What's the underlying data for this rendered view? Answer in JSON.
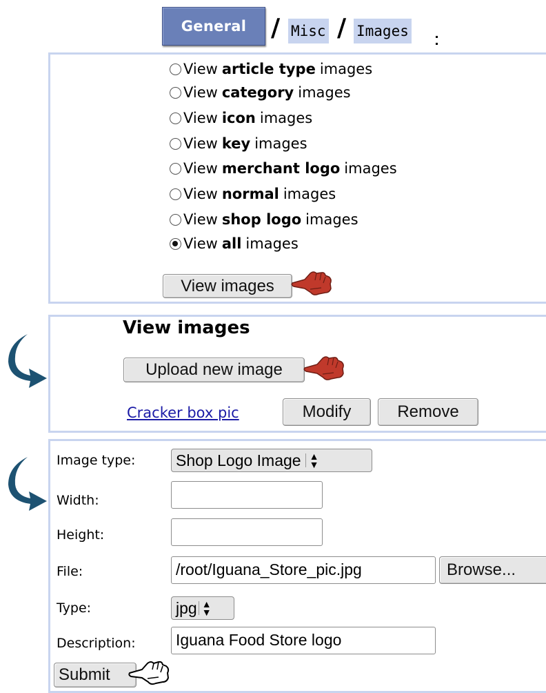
{
  "breadcrumb": {
    "general": "General",
    "slash1": "/",
    "misc": "Misc",
    "slash2": "/",
    "images": "Images"
  },
  "image_filter": {
    "options": [
      {
        "prefix": "View",
        "keyword": "article type",
        "suffix": "images",
        "checked": false
      },
      {
        "prefix": "View",
        "keyword": "category",
        "suffix": "images",
        "checked": false
      },
      {
        "prefix": "View",
        "keyword": "icon",
        "suffix": "images",
        "checked": false
      },
      {
        "prefix": "View",
        "keyword": "key",
        "suffix": "images",
        "checked": false
      },
      {
        "prefix": "View",
        "keyword": "merchant logo",
        "suffix": "images",
        "checked": false
      },
      {
        "prefix": "View",
        "keyword": "normal",
        "suffix": "images",
        "checked": false
      },
      {
        "prefix": "View",
        "keyword": "shop logo",
        "suffix": "images",
        "checked": false
      },
      {
        "prefix": "View",
        "keyword": "all",
        "suffix": "images",
        "checked": true
      }
    ],
    "view_button": "View images"
  },
  "view_images": {
    "heading": "View images",
    "upload_button": "Upload new image",
    "item_link": "Cracker box pic",
    "modify_button": "Modify",
    "remove_button": "Remove"
  },
  "upload_form": {
    "image_type_label": "Image type:",
    "image_type_value": "Shop Logo Image",
    "width_label": "Width:",
    "width_value": "",
    "height_label": "Height:",
    "height_value": "",
    "file_label": "File:",
    "file_value": "/root/Iguana_Store_pic.jpg",
    "browse_button": "Browse...",
    "type_label": "Type:",
    "type_value": "jpg",
    "description_label": "Description:",
    "description_value": "Iguana Food Store logo",
    "submit_button": "Submit"
  },
  "icons": {
    "step_arrow": "curved-arrow-icon",
    "pointer_red": "pointing-hand-icon",
    "pointer_white": "pointing-hand-outline-icon"
  },
  "colors": {
    "tab_blue": "#6a80b8",
    "panel_border": "#c8d4ef",
    "arrow": "#1d5272",
    "hand_red": "#c0392b",
    "link": "#1a1aa6"
  }
}
